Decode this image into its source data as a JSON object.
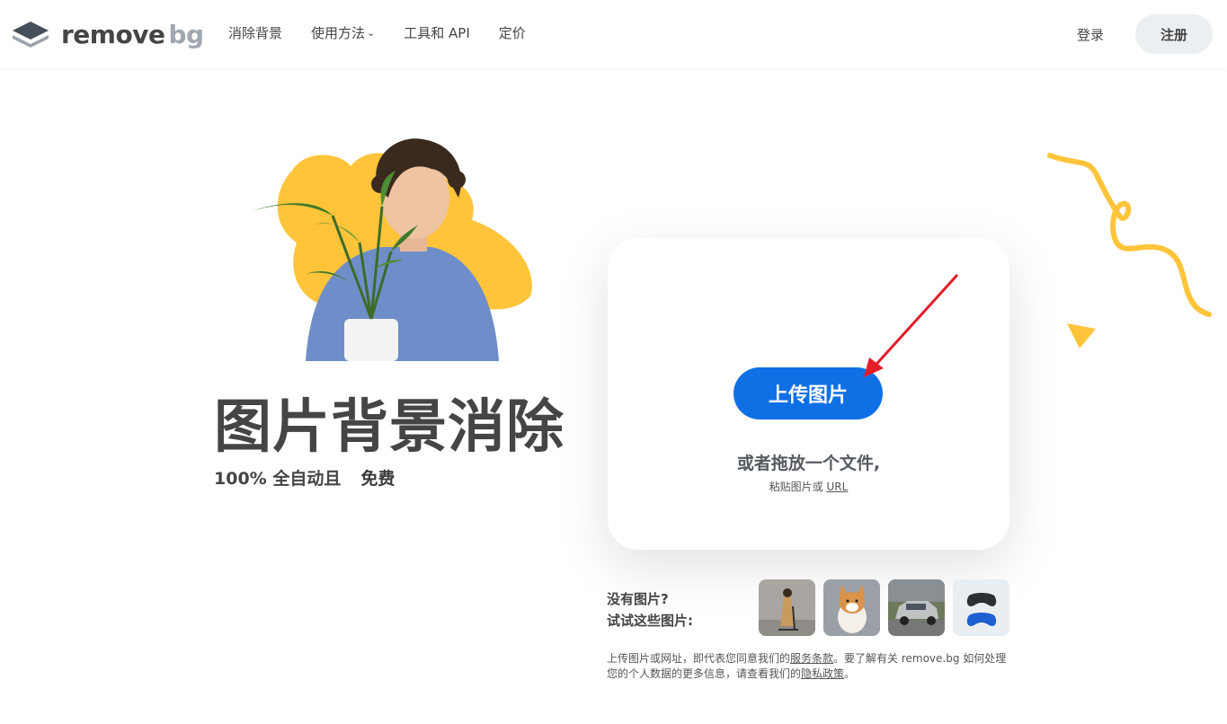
{
  "header": {
    "logo_text_a": "remove",
    "logo_text_b": "bg",
    "nav": [
      {
        "label": "消除背景"
      },
      {
        "label": "使用方法"
      },
      {
        "label": "工具和 API"
      },
      {
        "label": "定价"
      }
    ],
    "login_label": "登录",
    "signup_label": "注册"
  },
  "hero": {
    "title": "图片背景消除",
    "subtitle": "100% 全自动且",
    "badge": "免费"
  },
  "upload": {
    "button_label": "上传图片",
    "drop_text": "或者拖放一个文件,",
    "paste_prefix": "粘贴图片或 ",
    "paste_url": "URL"
  },
  "samples": {
    "line1": "没有图片?",
    "line2": "试试这些图片:",
    "items": [
      {
        "icon": "woman-scooter-photo"
      },
      {
        "icon": "corgi-dog-photo"
      },
      {
        "icon": "car-photo"
      },
      {
        "icon": "game-controllers-photo"
      }
    ]
  },
  "legal": {
    "part1": "上传图片或网址，即代表您同意我们的",
    "terms": "服务条款",
    "part2": "。要了解有关 remove.bg 如何处理您的个人数据的更多信息，请查看我们的",
    "privacy": "隐私政策",
    "part3": "。"
  },
  "colors": {
    "accent_blue": "#0f70e6",
    "yellow": "#ffc43a",
    "arrow_red": "#e11d2a"
  }
}
